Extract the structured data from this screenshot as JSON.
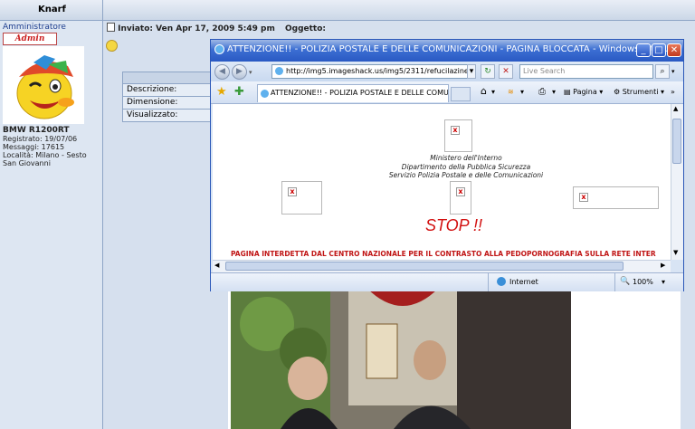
{
  "forum": {
    "author_name": "Knarf",
    "role": "Amministratore",
    "badge": "Admin",
    "user": {
      "title": "BMW R1200RT",
      "registered": "Registrato: 19/07/06",
      "messages": "Messaggi: 17615",
      "location": "Località: Milano - Sesto San Giovanni"
    },
    "post": {
      "sent": "Inviato: Ven Apr 17, 2009 5:49 pm",
      "subject_label": "Oggetto:"
    },
    "info_rows": [
      "Descrizione:",
      "Dimensione:",
      "Visualizzato:"
    ]
  },
  "ie": {
    "title": "ATTENZIONE!! - POLIZIA POSTALE E DELLE COMUNICAZIONI - PAGINA BLOCCATA - Windows Inte...",
    "url": "http://img5.imageshack.us/img5/2311/refucilazine.jpg",
    "search_placeholder": "Live Search",
    "tab_label": "ATTENZIONE!! - POLIZIA POSTALE E DELLE COMU...",
    "toolbar": {
      "page_label": "Pagina",
      "tools_label": "Strumenti"
    },
    "status": {
      "zone": "Internet",
      "zoom": "100%"
    },
    "colors": {
      "titlebar": "#3c6fd3",
      "stop_red": "#d21010"
    }
  },
  "blocked_page": {
    "ministry_lines": [
      "Ministero dell'Interno",
      "Dipartimento della Pubblica Sicurezza",
      "Servizio Polizia Postale e delle Comunicazioni"
    ],
    "stop": "STOP !!",
    "warning": "PAGINA INTERDETTA DAL CENTRO NAZIONALE PER IL CONTRASTO ALLA PEDOPORNOGRAFIA SULLA RETE INTER"
  }
}
